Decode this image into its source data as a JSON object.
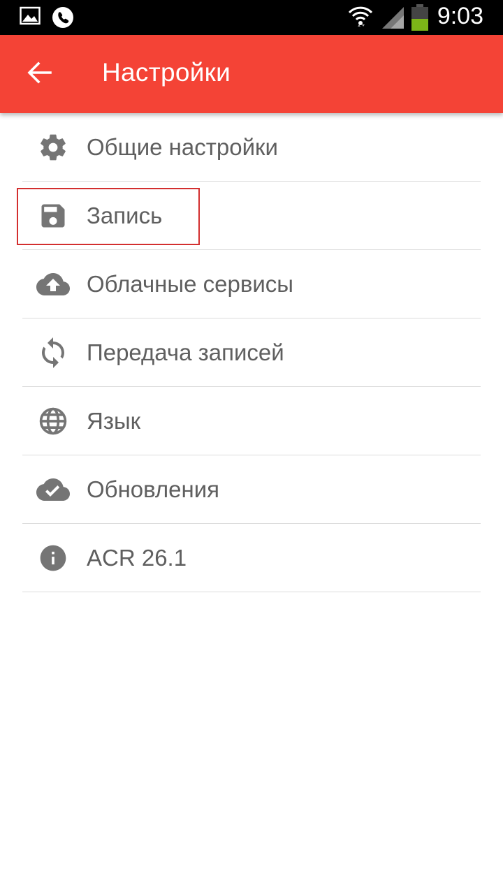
{
  "status_bar": {
    "time": "9:03",
    "battery_color": "#7cb518"
  },
  "toolbar": {
    "title": "Настройки",
    "background": "#f44336"
  },
  "menu": {
    "items": [
      {
        "label": "Общие настройки",
        "icon": "gear-icon"
      },
      {
        "label": "Запись",
        "icon": "save-icon"
      },
      {
        "label": "Облачные сервисы",
        "icon": "cloud-upload-icon"
      },
      {
        "label": "Передача записей",
        "icon": "sync-icon"
      },
      {
        "label": "Язык",
        "icon": "globe-icon"
      },
      {
        "label": "Обновления",
        "icon": "cloud-check-icon"
      },
      {
        "label": "ACR 26.1",
        "icon": "info-icon"
      }
    ]
  }
}
